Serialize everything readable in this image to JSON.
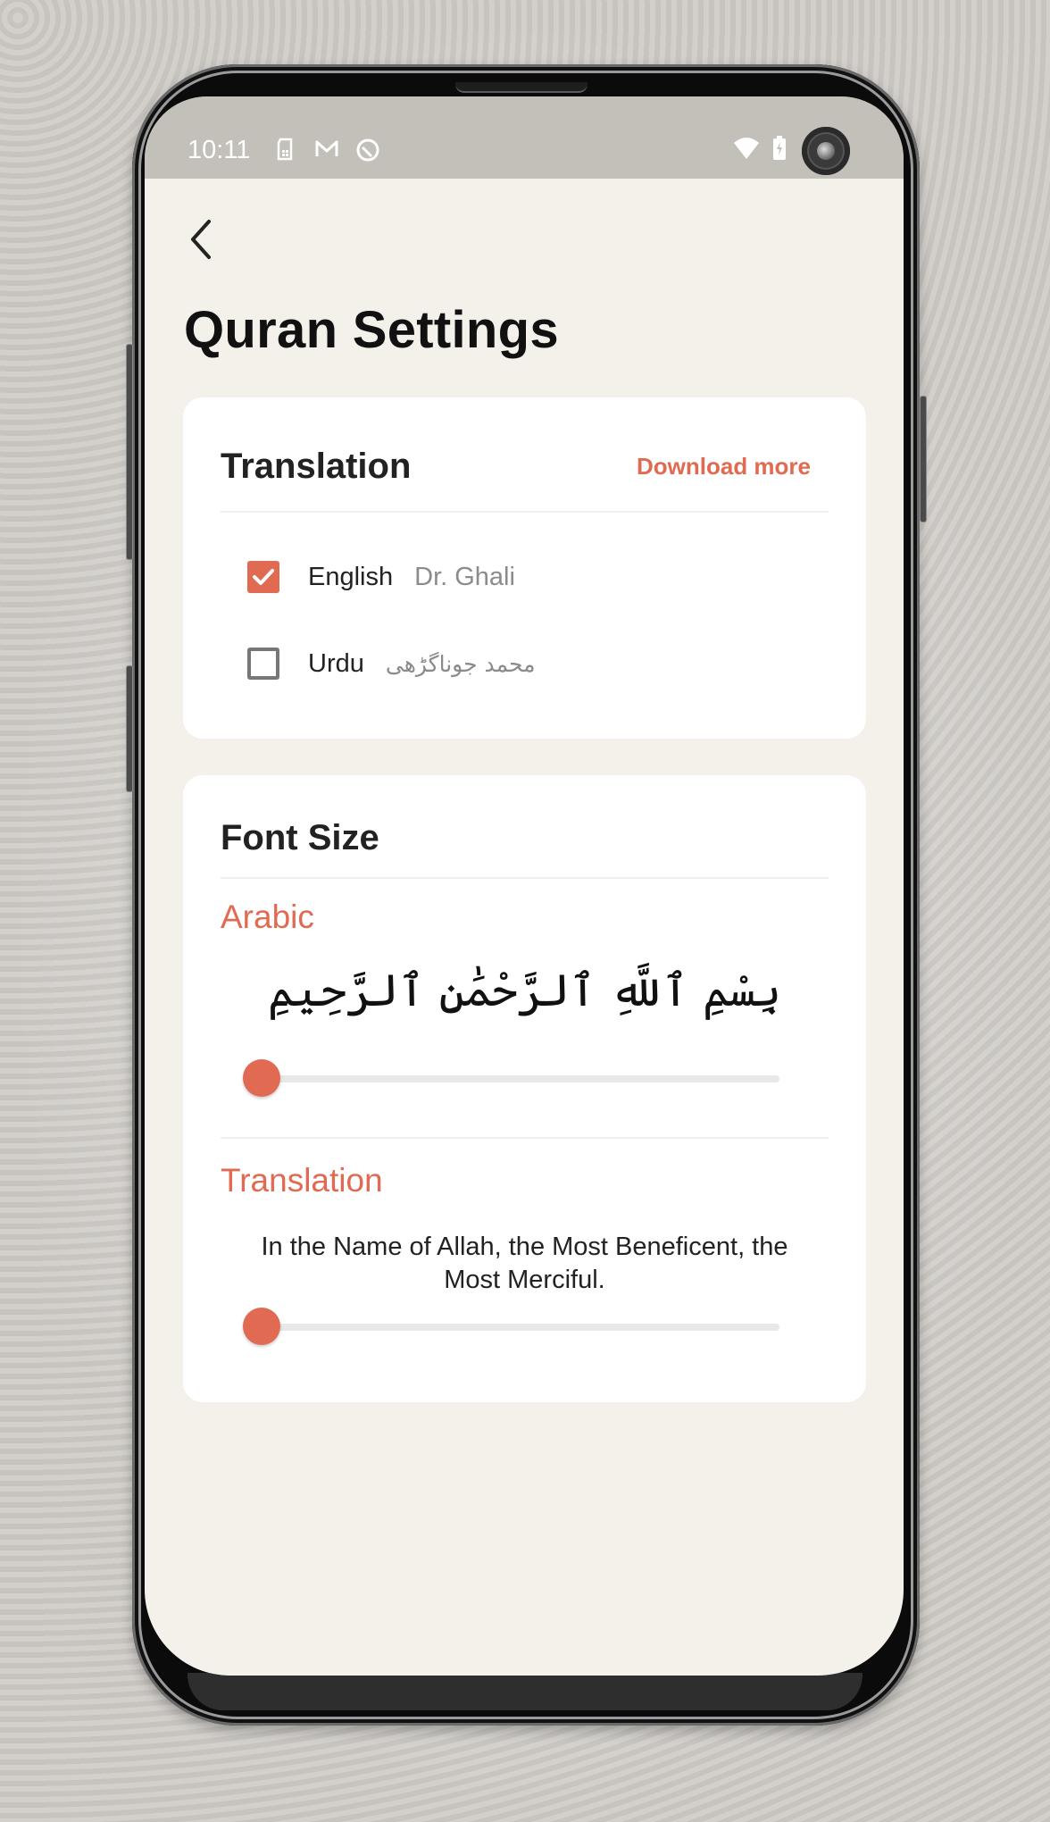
{
  "status_bar": {
    "time": "10:11",
    "left_icons": [
      "sim-card-icon",
      "gmail-icon",
      "quran-app-icon"
    ],
    "right_icons": [
      "wifi-icon",
      "battery-charging-icon"
    ]
  },
  "header": {
    "back_icon": "chevron-left-icon",
    "title": "Quran Settings"
  },
  "translation_card": {
    "title": "Translation",
    "download_more": "Download more",
    "languages": [
      {
        "name": "English",
        "author": "Dr. Ghali",
        "checked": true
      },
      {
        "name": "Urdu",
        "author": "محمد جوناگڑھی",
        "checked": false
      }
    ]
  },
  "font_size_card": {
    "title": "Font Size",
    "arabic": {
      "label": "Arabic",
      "sample": "بِسْمِ ٱللَّهِ ٱلرَّحْمَٰنِ ٱلرَّحِيمِ",
      "slider_value": 0
    },
    "translation": {
      "label": "Translation",
      "sample": "In the Name of Allah, the Most Beneficent, the Most Merciful.",
      "slider_value": 0
    }
  },
  "colors": {
    "accent": "#e06a52",
    "app_background": "#f4f0ea",
    "card_background": "#ffffff",
    "status_bar": "#c3bfb9"
  }
}
